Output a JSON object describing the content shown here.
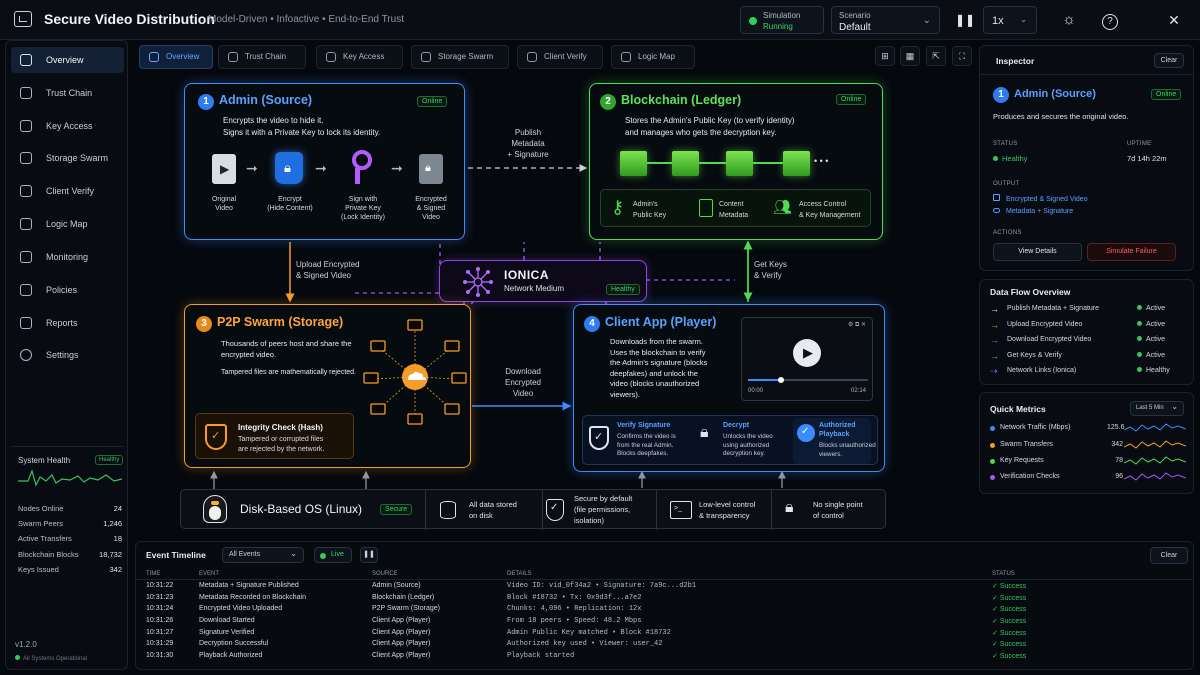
{
  "header": {
    "title": "Secure Video Distribution",
    "subtitle": "Model-Driven  •  Infoactive  •  End-to-End Trust",
    "simulation_label": "Simulation",
    "simulation_status": "Running",
    "scenario_label": "Scenario",
    "scenario_value": "Default",
    "speed": "1x"
  },
  "sidebar": {
    "items": [
      {
        "label": "Overview",
        "icon": "home-icon"
      },
      {
        "label": "Trust Chain",
        "icon": "chain-icon"
      },
      {
        "label": "Key Access",
        "icon": "key-icon"
      },
      {
        "label": "Storage Swarm",
        "icon": "database-icon"
      },
      {
        "label": "Client Verify",
        "icon": "shield-check-icon"
      },
      {
        "label": "Logic Map",
        "icon": "map-icon"
      },
      {
        "label": "Monitoring",
        "icon": "monitor-icon"
      },
      {
        "label": "Policies",
        "icon": "policy-icon"
      },
      {
        "label": "Reports",
        "icon": "report-icon"
      },
      {
        "label": "Settings",
        "icon": "gear-icon"
      }
    ],
    "health": {
      "title": "System Health",
      "badge": "Healthy",
      "rows": [
        {
          "label": "Nodes Online",
          "value": "24"
        },
        {
          "label": "Swarm Peers",
          "value": "1,246"
        },
        {
          "label": "Active Transfers",
          "value": "18"
        },
        {
          "label": "Blockchain Blocks",
          "value": "18,732"
        },
        {
          "label": "Keys Issued",
          "value": "342"
        }
      ]
    },
    "version": "v1.2.0",
    "ops": "All Systems Operational"
  },
  "tabs": [
    "Overview",
    "Trust Chain",
    "Key Access",
    "Storage Swarm",
    "Client Verify",
    "Logic Map"
  ],
  "diagram": {
    "admin": {
      "num": "1",
      "title": "Admin (Source)",
      "badge": "Online",
      "desc1": "Encrypts the video to hide it.",
      "desc2": "Signs it with a Private Key to lock its identity.",
      "steps": [
        {
          "l1": "Original",
          "l2": "Video",
          "l3": ""
        },
        {
          "l1": "Encrypt",
          "l2": "(Hide Content)",
          "l3": ""
        },
        {
          "l1": "Sign with",
          "l2": "Private Key",
          "l3": "(Lock Identity)"
        },
        {
          "l1": "Encrypted",
          "l2": "& Signed",
          "l3": "Video"
        }
      ]
    },
    "ledger": {
      "num": "2",
      "title": "Blockchain (Ledger)",
      "badge": "Online",
      "desc1": "Stores the Admin's Public Key (to verify identity)",
      "desc2": "and manages who gets the decryption key.",
      "ellipsis": "• • •",
      "items": [
        {
          "l1": "Admin's",
          "l2": "Public Key"
        },
        {
          "l1": "Content",
          "l2": "Metadata"
        },
        {
          "l1": "Access Control",
          "l2": "& Key Management"
        }
      ]
    },
    "swarm": {
      "num": "3",
      "title": "P2P Swarm (Storage)",
      "desc1": "Thousands of peers host and share the",
      "desc2": "encrypted video.",
      "desc3": "Tampered files are mathematically rejected.",
      "check_title": "Integrity Check (Hash)",
      "check_l1": "Tampered or corrupted files",
      "check_l2": "are rejected by the network."
    },
    "client": {
      "num": "4",
      "title": "Client App (Player)",
      "desc1": "Downloads from the swarm.",
      "desc2": "Uses the blockchain to verify",
      "desc3": "the Admin's signature (blocks",
      "desc4": "deepfakes) and unlock the",
      "desc5": "video (blocks unauthorized",
      "desc6": "viewers).",
      "time_start": "00:00",
      "time_end": "02:14",
      "features": [
        {
          "title": "Verify Signature",
          "l1": "Confirms the video is",
          "l2": "from the real Admin.",
          "l3": "Blocks deepfakes."
        },
        {
          "title": "Decrypt",
          "l1": "Unlocks the video",
          "l2": "using authorized",
          "l3": "decryption key."
        },
        {
          "title": "Authorized Playback",
          "l1": "Blocks unauthorized",
          "l2": "viewers.",
          "l3": ""
        }
      ]
    },
    "medium": {
      "title": "IONICA",
      "subtitle": "Network Medium",
      "badge": "Healthy"
    },
    "flows": {
      "publish_l1": "Publish",
      "publish_l2": "Metadata",
      "publish_l3": "+ Signature",
      "upload_l1": "Upload Encrypted",
      "upload_l2": "& Signed Video",
      "getkeys_l1": "Get Keys",
      "getkeys_l2": "& Verify",
      "download_l1": "Download",
      "download_l2": "Encrypted",
      "download_l3": "Video"
    },
    "os": {
      "title": "Disk-Based OS (Linux)",
      "badge": "Secure",
      "f1_l1": "All data stored",
      "f1_l2": "on disk",
      "f2_l1": "Secure by default",
      "f2_l2": "(file permissions,",
      "f2_l3": "isolation)",
      "f3_l1": "Low-level control",
      "f3_l2": "& transparency",
      "f4_l1": "No single point",
      "f4_l2": "of control"
    }
  },
  "events": {
    "title": "Event Timeline",
    "filter": "All Events",
    "live": "Live",
    "clear": "Clear",
    "columns": [
      "TIME",
      "EVENT",
      "SOURCE",
      "DETAILS",
      "STATUS"
    ],
    "rows": [
      {
        "time": "10:31:22",
        "event": "Metadata + Signature Published",
        "source": "Admin (Source)",
        "details": "Video ID: vid_0f34a2 • Signature: 7a9c...d2b1",
        "status": "Success"
      },
      {
        "time": "10:31:23",
        "event": "Metadata Recorded on Blockchain",
        "source": "Blockchain (Ledger)",
        "details": "Block #18732 • Tx: 0x9d3f...a7e2",
        "status": "Success"
      },
      {
        "time": "10:31:24",
        "event": "Encrypted Video Uploaded",
        "source": "P2P Swarm (Storage)",
        "details": "Chunks: 4,096 • Replication: 12x",
        "status": "Success"
      },
      {
        "time": "10:31:26",
        "event": "Download Started",
        "source": "Client App (Player)",
        "details": "From 18 peers • Speed: 48.2 Mbps",
        "status": "Success"
      },
      {
        "time": "10:31:27",
        "event": "Signature Verified",
        "source": "Client App (Player)",
        "details": "Admin Public Key matched • Block #18732",
        "status": "Success"
      },
      {
        "time": "10:31:29",
        "event": "Decryption Successful",
        "source": "Client App (Player)",
        "details": "Authorized key used • Viewer: user_42",
        "status": "Success"
      },
      {
        "time": "10:31:30",
        "event": "Playback Authorized",
        "source": "Client App (Player)",
        "details": "Playback started",
        "status": "Success"
      }
    ]
  },
  "inspector": {
    "title": "Inspector",
    "clear": "Clear",
    "num": "1",
    "name": "Admin (Source)",
    "badge": "Online",
    "desc": "Produces and secures the original video.",
    "status_label": "STATUS",
    "status_value": "Healthy",
    "uptime_label": "UPTIME",
    "uptime_value": "7d 14h 22m",
    "output_label": "OUTPUT",
    "output1": "Encrypted & Signed Video",
    "output2": "Metadata + Signature",
    "actions_label": "ACTIONS",
    "view_details": "View Details",
    "simulate_failure": "Simulate Failure"
  },
  "dataflow": {
    "title": "Data Flow Overview",
    "rows": [
      {
        "label": "Publish Metadata + Signature",
        "status": "Active",
        "color": "#e8edf3"
      },
      {
        "label": "Upload Encrypted Video",
        "status": "Active",
        "color": "#f59c2a"
      },
      {
        "label": "Download Encrypted Video",
        "status": "Active",
        "color": "#3b8cff"
      },
      {
        "label": "Get Keys & Verify",
        "status": "Active",
        "color": "#4ddb4f"
      },
      {
        "label": "Network Links (Ionica)",
        "status": "Healthy",
        "color": "#a557ff"
      }
    ]
  },
  "metrics": {
    "title": "Quick Metrics",
    "range": "Last 5 Min",
    "rows": [
      {
        "label": "Network Traffic (Mbps)",
        "value": "125.6",
        "color": "#3b8cff"
      },
      {
        "label": "Swarm Transfers",
        "value": "342",
        "color": "#f59c2a"
      },
      {
        "label": "Key Requests",
        "value": "78",
        "color": "#4ddb4f"
      },
      {
        "label": "Verification Checks",
        "value": "96",
        "color": "#a557ff"
      }
    ]
  },
  "colors": {
    "admin": "#3b8cff",
    "ledger": "#4ddb4f",
    "swarm": "#f59c2a",
    "client": "#3b8cff",
    "medium": "#a557ff",
    "success": "#37c463"
  }
}
